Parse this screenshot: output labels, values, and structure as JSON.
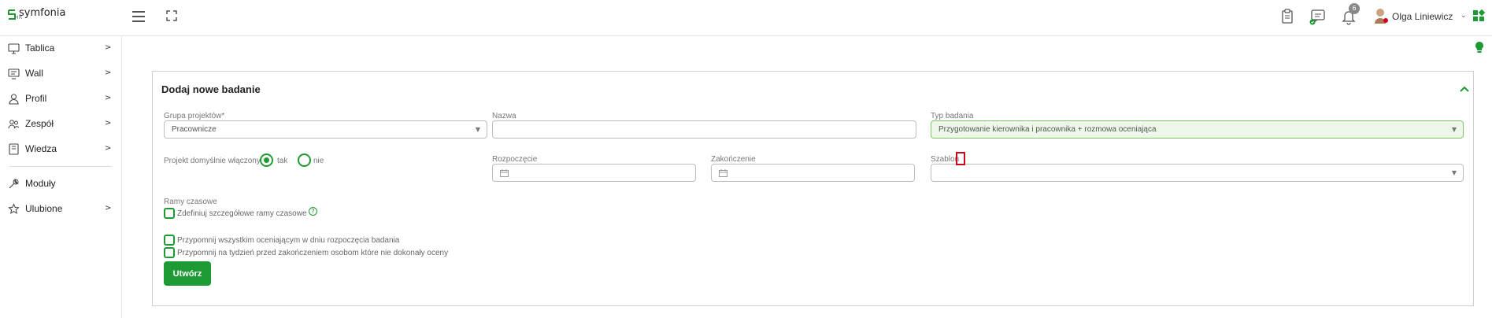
{
  "brand": {
    "name": "symfonia",
    "sub": "HR",
    "accent": "#1e9a35"
  },
  "header": {
    "notifications_count": "6",
    "user_name": "Olga Liniewicz"
  },
  "sidebar": {
    "items": [
      {
        "label": "Tablica",
        "icon": "monitor-icon",
        "chevron": ">"
      },
      {
        "label": "Wall",
        "icon": "wall-icon",
        "chevron": ">"
      },
      {
        "label": "Profil",
        "icon": "user-icon",
        "chevron": ">"
      },
      {
        "label": "Zespół",
        "icon": "team-icon",
        "chevron": ">"
      },
      {
        "label": "Wiedza",
        "icon": "book-icon",
        "chevron": ">"
      },
      {
        "label": "Moduły",
        "icon": "wrench-icon",
        "chevron": ""
      },
      {
        "label": "Ulubione",
        "icon": "star-icon",
        "chevron": ">"
      }
    ]
  },
  "form": {
    "title": "Dodaj nowe badanie",
    "group_label": "Grupa projektów*",
    "group_value": "Pracownicze",
    "name_label": "Nazwa",
    "name_value": "",
    "type_label": "Typ badania",
    "type_value": "Przygotowanie kierownika i pracownika + rozmowa oceniająca",
    "default_label": "Projekt domyślnie włączony",
    "default_yes": "tak",
    "default_no": "nie",
    "default_selected": "tak",
    "start_label": "Rozpoczęcie",
    "end_label": "Zakończenie",
    "template_label": "Szablon",
    "template_value": "",
    "timeframes_label": "Ramy czasowe",
    "timeframes_check": "Zdefiniuj szczegółowe ramy czasowe",
    "remind_start": "Przypomnij wszystkim oceniającym w dniu rozpoczęcia badania",
    "remind_week": "Przypomnij na tydzień przed zakończeniem osobom które nie dokonały oceny",
    "submit": "Utwórz"
  }
}
